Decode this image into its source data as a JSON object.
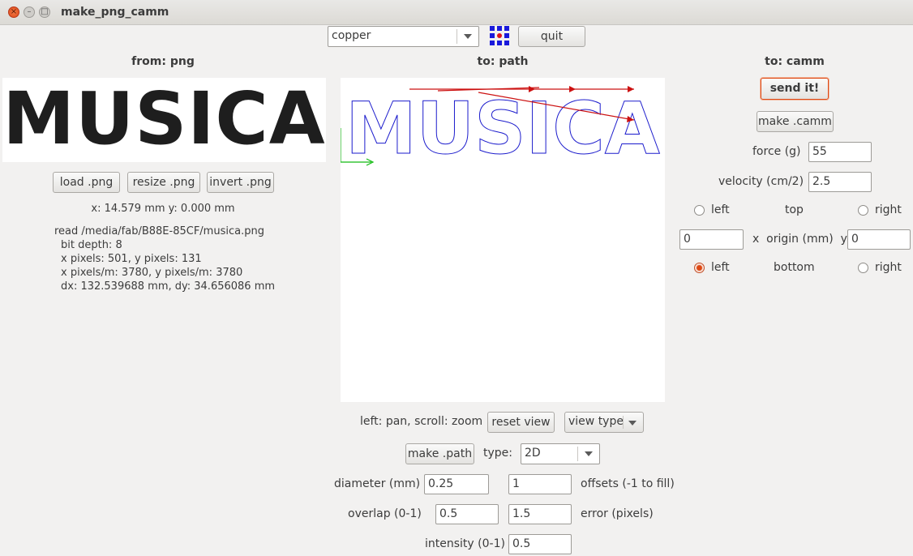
{
  "window": {
    "title": "make_png_camm"
  },
  "toolbar": {
    "material": "copper",
    "quit_label": "quit"
  },
  "left_panel": {
    "header": "from: png",
    "image_text": "MUSICA",
    "load_label": "load .png",
    "resize_label": "resize .png",
    "invert_label": "invert .png",
    "coords": "x: 14.579 mm  y: 0.000 mm",
    "info": [
      "read /media/fab/B88E-85CF/musica.png",
      "bit depth: 8",
      "x pixels: 501, y pixels: 131",
      "x pixels/m: 3780, y pixels/m: 3780",
      "dx: 132.539688 mm, dy: 34.656086 mm"
    ]
  },
  "middle_panel": {
    "header": "to: path",
    "path_text": "MUSICA",
    "hint": "left: pan, scroll: zoom",
    "reset_view_label": "reset view",
    "view_type_label": "view type",
    "make_path_label": "make .path",
    "type_label": "type:",
    "type_value": "2D",
    "diameter_label": "diameter (mm)",
    "diameter_value": "0.25",
    "offsets_value": "1",
    "offsets_label": "offsets (-1 to fill)",
    "overlap_label": "overlap (0-1)",
    "overlap_value": "0.5",
    "error_value": "1.5",
    "error_label": "error (pixels)",
    "intensity_label": "intensity (0-1)",
    "intensity_value": "0.5"
  },
  "right_panel": {
    "header": "to: camm",
    "send_label": "send it!",
    "make_camm_label": "make .camm",
    "force_label": "force (g)",
    "force_value": "55",
    "velocity_label": "velocity (cm/2)",
    "velocity_value": "2.5",
    "top_left_label": "left",
    "top_label": "top",
    "top_right_label": "right",
    "x_origin_value": "0",
    "origin_label": "x  origin (mm)  y",
    "y_origin_value": "0",
    "bottom_left_label": "left",
    "bottom_label": "bottom",
    "bottom_right_label": "right",
    "origin_selected": "bottom-left"
  },
  "colors": {
    "path_blue": "#1a1acc",
    "move_red": "#cc1111",
    "axis_green": "#11bb11",
    "accent": "#dd4814"
  }
}
